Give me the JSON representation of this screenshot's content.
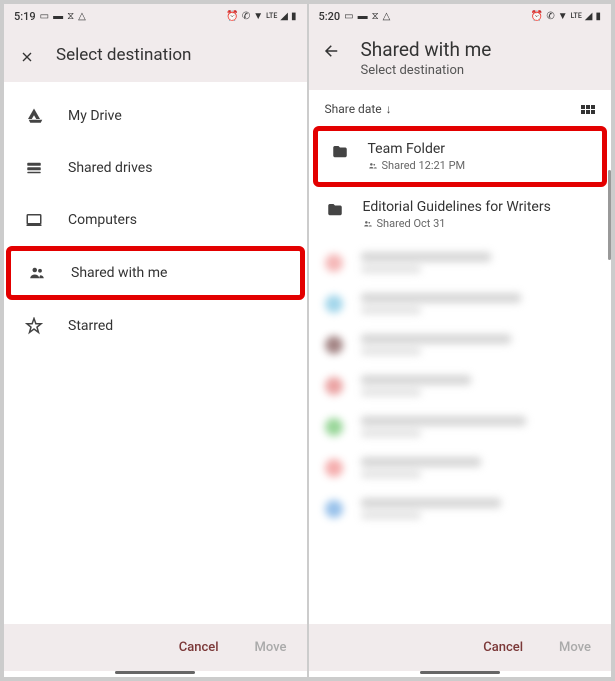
{
  "left": {
    "status": {
      "time": "5:19",
      "icons_left": [
        "▭",
        "▬",
        "⧖",
        "△"
      ],
      "icons_right": [
        "⏰",
        "📞",
        "📶",
        "LTE",
        "◢",
        "▮"
      ]
    },
    "header": {
      "close_icon": "✕",
      "title": "Select destination"
    },
    "nav": [
      {
        "icon": "drive",
        "label": "My Drive",
        "highlighted": false
      },
      {
        "icon": "shared-drives",
        "label": "Shared drives",
        "highlighted": false
      },
      {
        "icon": "computers",
        "label": "Computers",
        "highlighted": false
      },
      {
        "icon": "shared-with-me",
        "label": "Shared with me",
        "highlighted": true
      },
      {
        "icon": "starred",
        "label": "Starred",
        "highlighted": false
      }
    ],
    "footer": {
      "cancel": "Cancel",
      "move": "Move"
    }
  },
  "right": {
    "status": {
      "time": "5:20",
      "icons_left": [
        "▭",
        "▬",
        "⧖",
        "△"
      ],
      "icons_right": [
        "⏰",
        "📞",
        "📶",
        "LTE",
        "◢",
        "▮"
      ]
    },
    "header": {
      "back_icon": "←",
      "title": "Shared with me",
      "subtitle": "Select destination"
    },
    "sort": {
      "label": "Share date",
      "arrow": "↓"
    },
    "folders": [
      {
        "name": "Team Folder",
        "meta": "Shared 12:21 PM",
        "highlighted": true
      },
      {
        "name": "Editorial Guidelines for Writers",
        "meta": "Shared Oct 31",
        "highlighted": false
      }
    ],
    "blurred": [
      {
        "color": "#e88",
        "w": 130
      },
      {
        "color": "#6bd",
        "w": 160
      },
      {
        "color": "#633",
        "w": 150
      },
      {
        "color": "#d66",
        "w": 110
      },
      {
        "color": "#5b5",
        "w": 165
      },
      {
        "color": "#e77",
        "w": 120
      },
      {
        "color": "#59d",
        "w": 140
      }
    ],
    "footer": {
      "cancel": "Cancel",
      "move": "Move"
    }
  }
}
